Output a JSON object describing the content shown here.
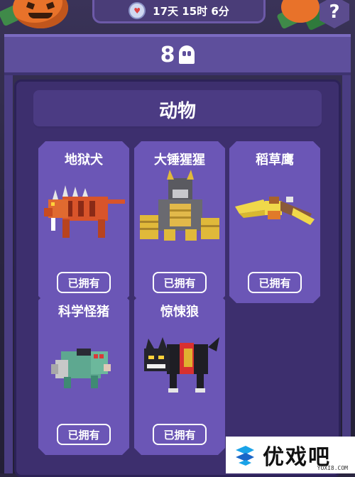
{
  "topbar": {
    "timer_text": "17天 15时 6分",
    "help_label": "?"
  },
  "banner": {
    "count": "8",
    "icon": "ghost-icon"
  },
  "category": {
    "title": "动物"
  },
  "cards": [
    {
      "name": "地狱犬",
      "button": "已拥有",
      "icon": "hellhound-creature"
    },
    {
      "name": "大锤猩猩",
      "button": "已拥有",
      "icon": "hammer-gorilla-creature"
    },
    {
      "name": "稻草鹰",
      "button": "已拥有",
      "icon": "scarecrow-eagle-creature"
    },
    {
      "name": "科学怪猪",
      "button": "已拥有",
      "icon": "franken-pig-creature"
    },
    {
      "name": "惊悚狼",
      "button": "已拥有",
      "icon": "creepy-wolf-creature"
    }
  ],
  "watermark": {
    "brand": "优戏吧",
    "url": "YOXI8.COM"
  },
  "colors": {
    "panel": "#3d2f6e",
    "card": "#6b56b6",
    "banner": "#5e4f9c",
    "accent_orange": "#e8722a"
  }
}
